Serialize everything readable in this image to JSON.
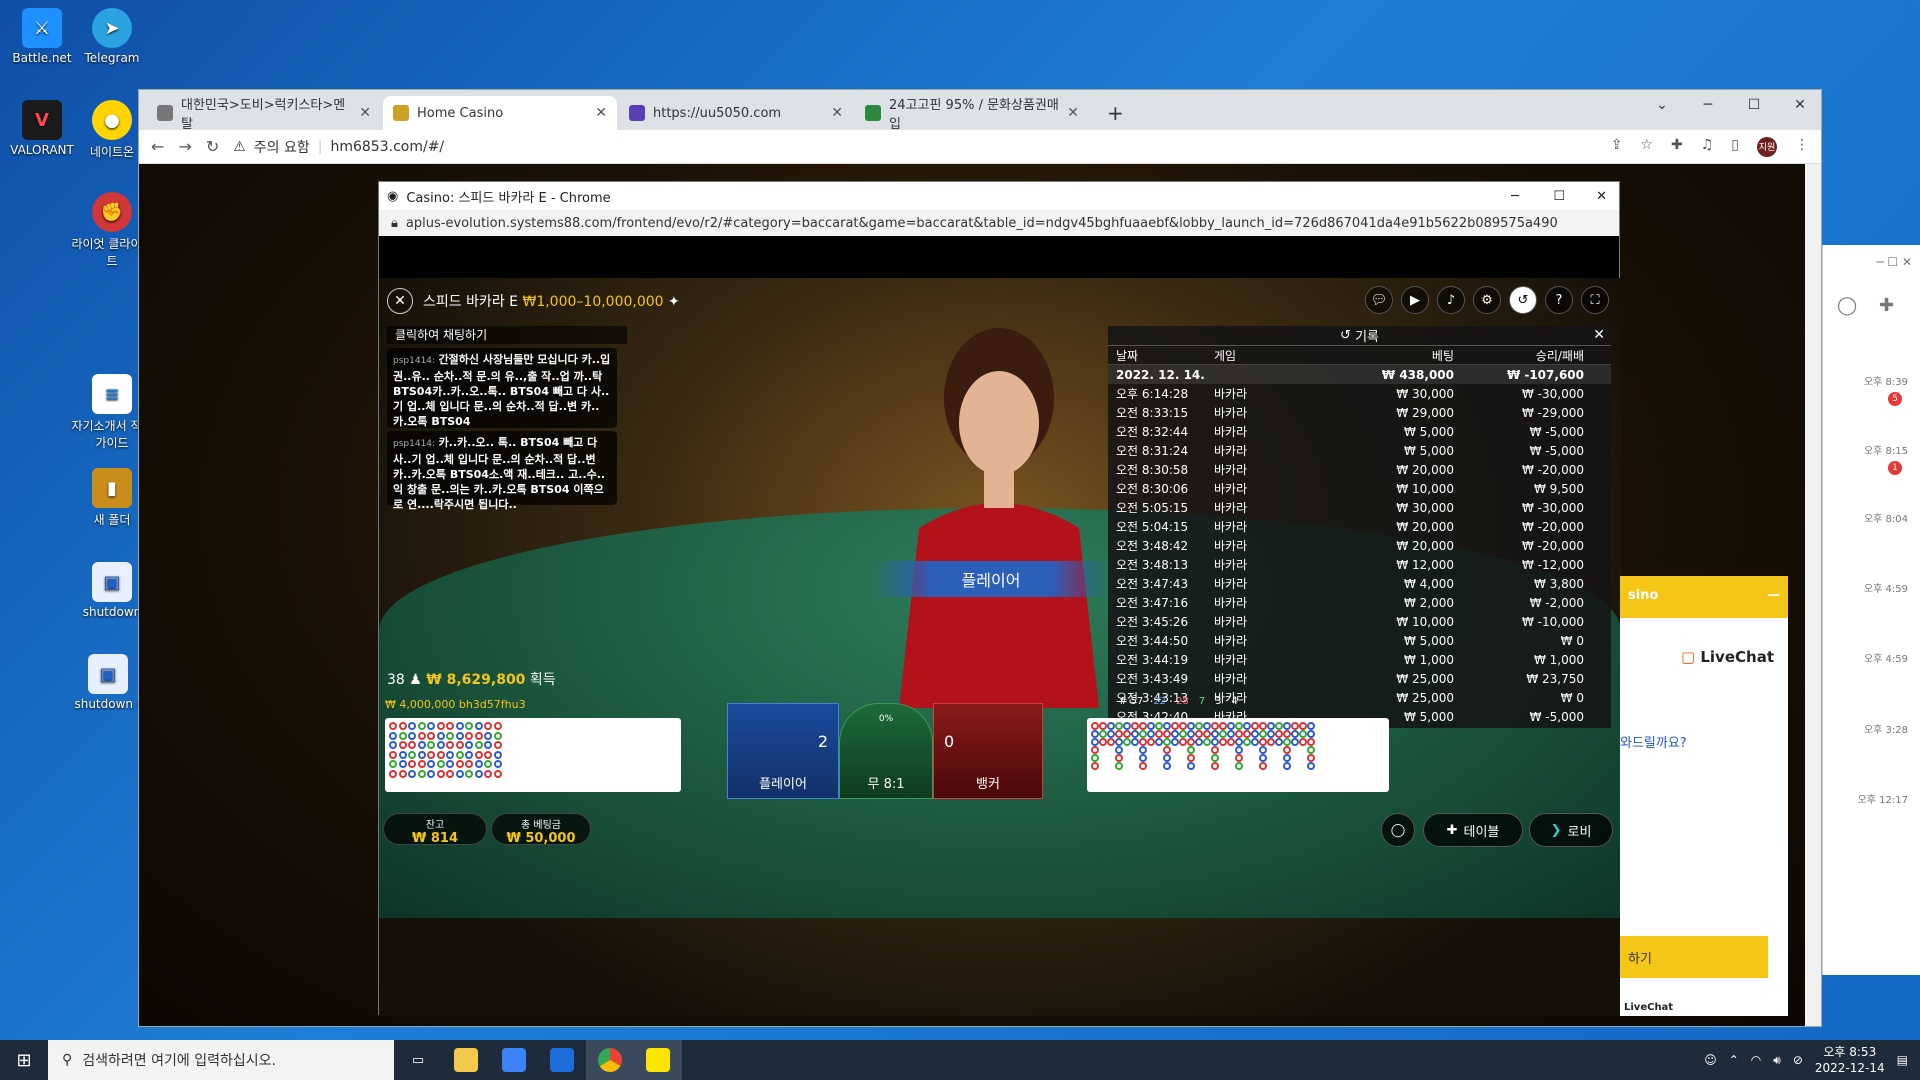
{
  "desktop": {
    "icons": [
      "Battle.net",
      "Telegram",
      "VALORANT",
      "네이트온",
      "라이엇 클라이언트",
      "자기소개서 작성 가이드",
      "새 폴더",
      "shutdown",
      "shutdown ("
    ]
  },
  "browser": {
    "tabs": [
      {
        "title": "대한민국>도비>럭키스타>멘탈"
      },
      {
        "title": "Home Casino"
      },
      {
        "title": "https://uu5050.com"
      },
      {
        "title": "24고고핀 95% / 문화상품권매입"
      }
    ],
    "newtab": "+",
    "security": "주의 요함",
    "url": "hm6853.com/#/",
    "avatar": "지원"
  },
  "popup": {
    "title": "Casino: 스피드 바카라 E - Chrome",
    "url": "aplus-evolution.systems88.com/frontend/evo/r2/#category=baccarat&game=baccarat&table_id=ndgv45bghfuaaebf&lobby_launch_id=726d867041da4e91b5622b089575a490"
  },
  "game": {
    "title": "스피드 바카라 E",
    "limits": "₩1,000–10,000,000",
    "chat_label": "클릭하여 채팅하기",
    "chat": [
      {
        "nick": "psp1414:",
        "text": "간절하신 사장님들만 모십니다 카..입권..유.. 순차..적 문.의 유..,출 작..업 까..탁 BTS04카..카..오..톡.. BTS04 빼고 다 사..기 업..체 입니다 문..의 순차..적 답..변 카..카.오톡 BTS04"
      },
      {
        "nick": "psp1414:",
        "text": "카..카..오.. 톡.. BTS04 빼고 다 사..기 업..체 입니다 문..의 순차..적 답..변 카..카.오톡 BTS04소.액 재..테크.. 고..수..익 창출 문..의는 카..카.오톡 BTS04 이쪽으로 연....락주시면 됩니다.."
      }
    ],
    "result_banner": "플레이어",
    "winners": "38",
    "winners_amount": "₩ 8,629,800",
    "winners_suffix": "획득",
    "top_bet": "₩ 4,000,000 bh3d57fhu3",
    "history": {
      "title": "기록",
      "cols": [
        "날짜",
        "게임",
        "베팅",
        "승리/패배"
      ],
      "date_row": {
        "date": "2022. 12. 14.",
        "bet": "₩ 438,000",
        "result": "₩ -107,600"
      },
      "rows": [
        [
          "오후 6:14:28",
          "바카라",
          "₩ 30,000",
          "₩ -30,000"
        ],
        [
          "오전 8:33:15",
          "바카라",
          "₩ 29,000",
          "₩ -29,000"
        ],
        [
          "오전 8:32:44",
          "바카라",
          "₩ 5,000",
          "₩ -5,000"
        ],
        [
          "오전 8:31:24",
          "바카라",
          "₩ 5,000",
          "₩ -5,000"
        ],
        [
          "오전 8:30:58",
          "바카라",
          "₩ 20,000",
          "₩ -20,000"
        ],
        [
          "오전 8:30:06",
          "바카라",
          "₩ 10,000",
          "₩ 9,500"
        ],
        [
          "오전 5:05:15",
          "바카라",
          "₩ 30,000",
          "₩ -30,000"
        ],
        [
          "오전 5:04:15",
          "바카라",
          "₩ 20,000",
          "₩ -20,000"
        ],
        [
          "오전 3:48:42",
          "바카라",
          "₩ 20,000",
          "₩ -20,000"
        ],
        [
          "오전 3:48:13",
          "바카라",
          "₩ 12,000",
          "₩ -12,000"
        ],
        [
          "오전 3:47:43",
          "바카라",
          "₩ 4,000",
          "₩ 3,800"
        ],
        [
          "오전 3:47:16",
          "바카라",
          "₩ 2,000",
          "₩ -2,000"
        ],
        [
          "오전 3:45:26",
          "바카라",
          "₩ 10,000",
          "₩ -10,000"
        ],
        [
          "오전 3:44:50",
          "바카라",
          "₩ 5,000",
          "₩ 0"
        ],
        [
          "오전 3:44:19",
          "바카라",
          "₩ 1,000",
          "₩ 1,000"
        ],
        [
          "오전 3:43:49",
          "바카라",
          "₩ 25,000",
          "₩ 23,750"
        ],
        [
          "오전 3:43:13",
          "바카라",
          "₩ 25,000",
          "₩ 0"
        ],
        [
          "오전 3:42:40",
          "바카라",
          "₩ 5,000",
          "₩ -5,000"
        ]
      ]
    },
    "bet": {
      "player_label": "플레이어",
      "player_score": "2",
      "tie_label": "무 8:1",
      "tie_pct": "0%",
      "banker_label": "뱅커",
      "banker_score": "0"
    },
    "stats": [
      "# 57",
      "22",
      "28",
      "7",
      "3",
      "4"
    ],
    "balance_label": "잔고",
    "balance": "₩ 814",
    "total_bet_label": "총 베팅금",
    "total_bet": "₩ 50,000",
    "table_btn": "테이블",
    "lobby_btn": "로비"
  },
  "livechat": {
    "header": "sino",
    "brand": "LiveChat",
    "question": "와드릴까요?",
    "button": "하기",
    "footer": "LiveChat"
  },
  "kakao": {
    "times": [
      "오후 8:39",
      "오후 8:15",
      "오후 8:04",
      "오후 4:59",
      "오후 4:59",
      "오후 3:28",
      "오후 12:17"
    ],
    "badges": [
      "5",
      "1"
    ]
  },
  "taskbar": {
    "search": "검색하려면 여기에 입력하십시오.",
    "time": "오후 8:53",
    "date": "2022-12-14"
  }
}
